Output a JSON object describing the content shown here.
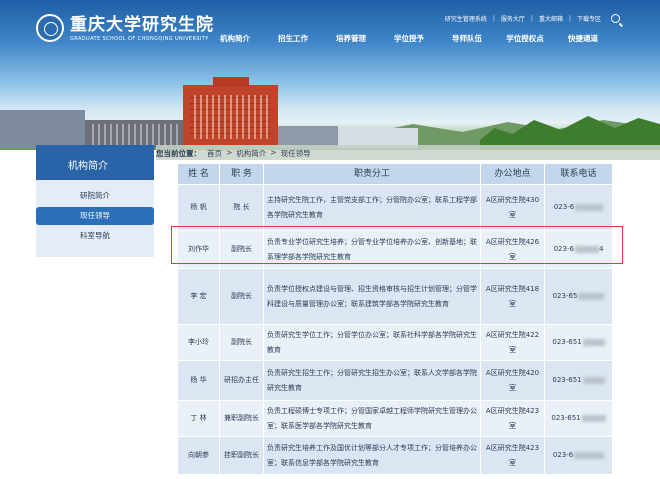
{
  "header": {
    "logo_cn": "重庆大学研究生院",
    "logo_en": "GRADUATE SCHOOL OF CHONGQING UNIVERSITY",
    "top_links": [
      "研究生管理系统",
      "服务大厅",
      "重大邮箱",
      "下载专区"
    ],
    "nav": [
      "机构简介",
      "招生工作",
      "培养管理",
      "学位授予",
      "导师队伍",
      "学位授权点",
      "快捷通道"
    ],
    "tower_sign": "重庆大学"
  },
  "sidebar": {
    "title": "机构简介",
    "items": [
      {
        "label": "研院简介",
        "active": false
      },
      {
        "label": "现任领导",
        "active": true
      },
      {
        "label": "科室导航",
        "active": false
      }
    ]
  },
  "breadcrumb": {
    "label": "您当前位置：",
    "path": [
      "首页",
      "机构简介",
      "现任领导"
    ]
  },
  "table": {
    "headers": [
      "姓 名",
      "职 务",
      "职责分工",
      "办公地点",
      "联系电话"
    ],
    "rows": [
      {
        "name": "杨 帆",
        "role": "院 长",
        "duty": "主持研究生院工作，主管党支部工作；分管院办公室；联系工程学部各学院研究生教育",
        "office": "A区研究生院430室",
        "phone_prefix": "023-6",
        "phone_suffix": ""
      },
      {
        "name": "刘作华",
        "role": "副院长",
        "duty": "负责专业学位研究生培养；分管专业学位培养办公室、创新基地；联系理学部各学院研究生教育",
        "office": "A区研究生院426室",
        "phone_prefix": "023-6",
        "phone_suffix": "4"
      },
      {
        "name": "李 宏",
        "role": "副院长",
        "duty": "负责学位授权点建设与管理、招生资格审核与招生计划管理；分管学科建设与质量管理办公室；联系建筑学部各学院研究生教育",
        "office": "A区研究生院418室",
        "phone_prefix": "023-65",
        "phone_suffix": ""
      },
      {
        "name": "李小玲",
        "role": "副院长",
        "duty": "负责研究生学位工作；分管学位办公室；联系社科学部各学院研究生教育",
        "office": "A区研究生院422室",
        "phone_prefix": "023-651",
        "phone_suffix": ""
      },
      {
        "name": "杨 华",
        "role": "研招办主任",
        "duty": "负责研究生招生工作；分管研究生招生办公室；联系人文学部各学院研究生教育",
        "office": "A区研究生院420室",
        "phone_prefix": "023-651",
        "phone_suffix": ""
      },
      {
        "name": "丁 林",
        "role": "兼职副院长",
        "duty": "负责工程硕博士专项工作；分管国家卓越工程师学院研究生管理办公室；联系医学部各学院研究生教育",
        "office": "A区研究生院423室",
        "phone_prefix": "023-651",
        "phone_suffix": ""
      },
      {
        "name": "向朝参",
        "role": "挂职副院长",
        "duty": "负责研究生培养工作及国优计划等部分人才专项工作；分管培养办公室；联系信息学部各学院研究生教育",
        "office": "A区研究生院423室",
        "phone_prefix": "023-6",
        "phone_suffix": ""
      }
    ]
  },
  "colors": {
    "sidebar_title_bg": "#2a64a8",
    "active_item_bg": "#2a6fb8",
    "table_header_bg": "#c4d6ec",
    "highlight_border": "#e53935"
  }
}
